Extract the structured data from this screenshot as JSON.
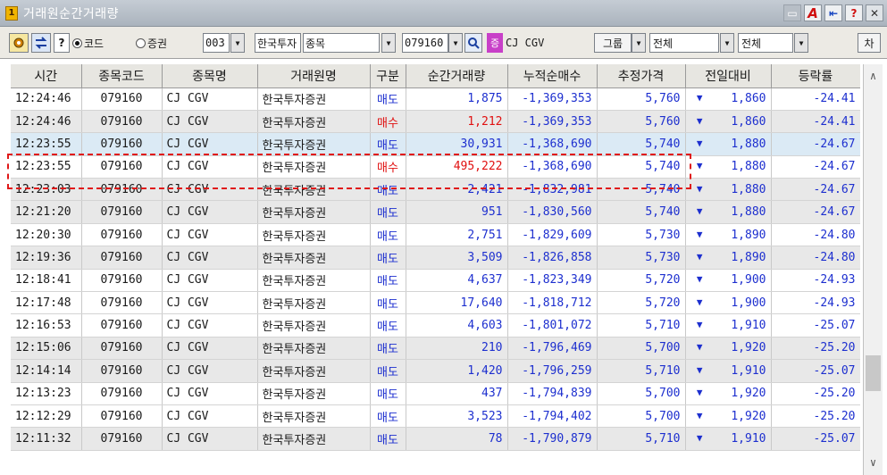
{
  "window": {
    "title": "거래원순간거래량",
    "icon_label": "1"
  },
  "toolbar": {
    "help_q": "?",
    "radio_code": "코드",
    "radio_broker": "증권",
    "broker_code": "003",
    "broker_name": "한국투자",
    "kind_select": "종목",
    "stock_code": "079160",
    "chip": "증",
    "stock_name": "CJ CGV",
    "group_btn": "그룹",
    "filter1": "전체",
    "filter2": "전체",
    "chart_btn": "차"
  },
  "table": {
    "headers": [
      "시간",
      "종목코드",
      "종목명",
      "거래원명",
      "구분",
      "순간거래량",
      "누적순매수",
      "추정가격",
      "전일대비",
      "등락률"
    ],
    "rows": [
      {
        "time": "12:24:46",
        "code": "079160",
        "name": "CJ CGV",
        "broker": "한국투자증권",
        "side": "매도",
        "vol": "1,875",
        "cum": "-1,369,353",
        "price": "5,760",
        "diff": "1,860",
        "rate": "-24.41"
      },
      {
        "time": "12:24:46",
        "code": "079160",
        "name": "CJ CGV",
        "broker": "한국투자증권",
        "side": "매수",
        "vol": "1,212",
        "cum": "-1,369,353",
        "price": "5,760",
        "diff": "1,860",
        "rate": "-24.41"
      },
      {
        "time": "12:23:55",
        "code": "079160",
        "name": "CJ CGV",
        "broker": "한국투자증권",
        "side": "매도",
        "vol": "30,931",
        "cum": "-1,368,690",
        "price": "5,740",
        "diff": "1,880",
        "rate": "-24.67"
      },
      {
        "time": "12:23:55",
        "code": "079160",
        "name": "CJ CGV",
        "broker": "한국투자증권",
        "side": "매수",
        "vol": "495,222",
        "cum": "-1,368,690",
        "price": "5,740",
        "diff": "1,880",
        "rate": "-24.67"
      },
      {
        "time": "12:23:03",
        "code": "079160",
        "name": "CJ CGV",
        "broker": "한국투자증권",
        "side": "매도",
        "vol": "2,421",
        "cum": "-1,832,981",
        "price": "5,740",
        "diff": "1,880",
        "rate": "-24.67"
      },
      {
        "time": "12:21:20",
        "code": "079160",
        "name": "CJ CGV",
        "broker": "한국투자증권",
        "side": "매도",
        "vol": "951",
        "cum": "-1,830,560",
        "price": "5,740",
        "diff": "1,880",
        "rate": "-24.67"
      },
      {
        "time": "12:20:30",
        "code": "079160",
        "name": "CJ CGV",
        "broker": "한국투자증권",
        "side": "매도",
        "vol": "2,751",
        "cum": "-1,829,609",
        "price": "5,730",
        "diff": "1,890",
        "rate": "-24.80"
      },
      {
        "time": "12:19:36",
        "code": "079160",
        "name": "CJ CGV",
        "broker": "한국투자증권",
        "side": "매도",
        "vol": "3,509",
        "cum": "-1,826,858",
        "price": "5,730",
        "diff": "1,890",
        "rate": "-24.80"
      },
      {
        "time": "12:18:41",
        "code": "079160",
        "name": "CJ CGV",
        "broker": "한국투자증권",
        "side": "매도",
        "vol": "4,637",
        "cum": "-1,823,349",
        "price": "5,720",
        "diff": "1,900",
        "rate": "-24.93"
      },
      {
        "time": "12:17:48",
        "code": "079160",
        "name": "CJ CGV",
        "broker": "한국투자증권",
        "side": "매도",
        "vol": "17,640",
        "cum": "-1,818,712",
        "price": "5,720",
        "diff": "1,900",
        "rate": "-24.93"
      },
      {
        "time": "12:16:53",
        "code": "079160",
        "name": "CJ CGV",
        "broker": "한국투자증권",
        "side": "매도",
        "vol": "4,603",
        "cum": "-1,801,072",
        "price": "5,710",
        "diff": "1,910",
        "rate": "-25.07"
      },
      {
        "time": "12:15:06",
        "code": "079160",
        "name": "CJ CGV",
        "broker": "한국투자증권",
        "side": "매도",
        "vol": "210",
        "cum": "-1,796,469",
        "price": "5,700",
        "diff": "1,920",
        "rate": "-25.20"
      },
      {
        "time": "12:14:14",
        "code": "079160",
        "name": "CJ CGV",
        "broker": "한국투자증권",
        "side": "매도",
        "vol": "1,420",
        "cum": "-1,796,259",
        "price": "5,710",
        "diff": "1,910",
        "rate": "-25.07"
      },
      {
        "time": "12:13:23",
        "code": "079160",
        "name": "CJ CGV",
        "broker": "한국투자증권",
        "side": "매도",
        "vol": "437",
        "cum": "-1,794,839",
        "price": "5,700",
        "diff": "1,920",
        "rate": "-25.20"
      },
      {
        "time": "12:12:29",
        "code": "079160",
        "name": "CJ CGV",
        "broker": "한국투자증권",
        "side": "매도",
        "vol": "3,523",
        "cum": "-1,794,402",
        "price": "5,700",
        "diff": "1,920",
        "rate": "-25.20"
      },
      {
        "time": "12:11:32",
        "code": "079160",
        "name": "CJ CGV",
        "broker": "한국투자증권",
        "side": "매도",
        "vol": "78",
        "cum": "-1,790,879",
        "price": "5,710",
        "diff": "1,910",
        "rate": "-25.07"
      }
    ]
  },
  "colors": {
    "sell": "#1d2fcf",
    "buy": "#e01010",
    "highlight": "#e01818",
    "selected_row": "#dbeaf5"
  },
  "icons": {
    "settings": "gear-icon",
    "refresh": "swap-arrows-icon",
    "search": "magnifier-icon",
    "down": "down-triangle-icon"
  }
}
